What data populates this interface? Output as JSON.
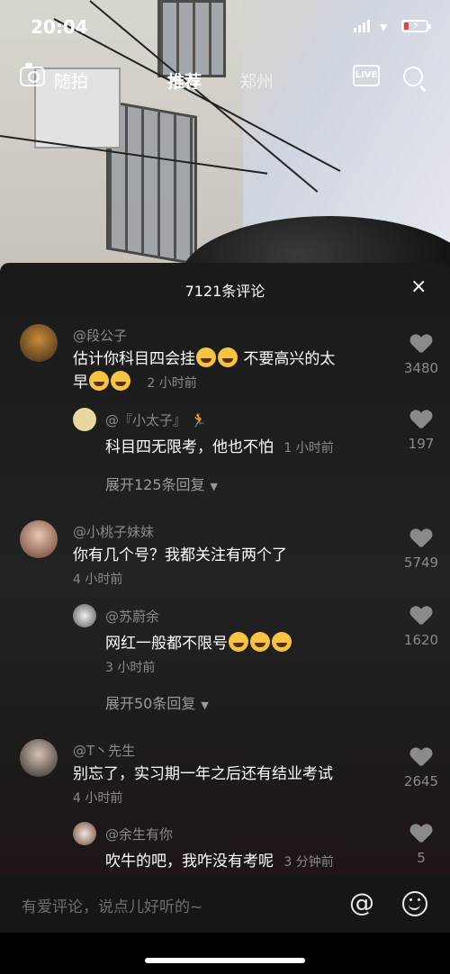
{
  "status_bar": {
    "time": "20:04"
  },
  "top_nav": {
    "camera_label": "随拍",
    "tab_recommend": "推荐",
    "tab_city": "郑州",
    "live_badge": "LIVE"
  },
  "comments_sheet": {
    "title": "7121条评论",
    "close": "×",
    "comments": [
      {
        "user": "@段公子",
        "text_line1": "估计你科目四会挂",
        "text_line1_after": " 不要高兴的太",
        "text_line2": "早",
        "time": "2 小时前",
        "likes": "3480",
        "reply": {
          "user": "@『小太子』",
          "text": "科目四无限考，他也不怕",
          "time": "1 小时前",
          "likes": "197"
        },
        "expand": "展开125条回复"
      },
      {
        "user": "@小桃子妹妹",
        "text": "你有几个号？我都关注有两个了",
        "time": "4 小时前",
        "likes": "5749",
        "reply": {
          "user": "@苏蔚余",
          "text": "网红一般都不限号",
          "time": "3 小时前",
          "likes": "1620"
        },
        "expand": "展开50条回复"
      },
      {
        "user": "@T丶先生",
        "text": "别忘了，实习期一年之后还有结业考试",
        "time": "4 小时前",
        "likes": "2645",
        "reply": {
          "user": "@余生有你",
          "text": "吹牛的吧，我咋没有考呢",
          "time": "3 分钟前",
          "likes": "5"
        }
      }
    ]
  },
  "input_bar": {
    "placeholder": "有爱评论，说点儿好听的~",
    "at_symbol": "@"
  },
  "colors": {
    "sheet_bg": "#1f1f20",
    "muted_text": "#8a8a8a",
    "battery_low": "#ff3b30"
  }
}
